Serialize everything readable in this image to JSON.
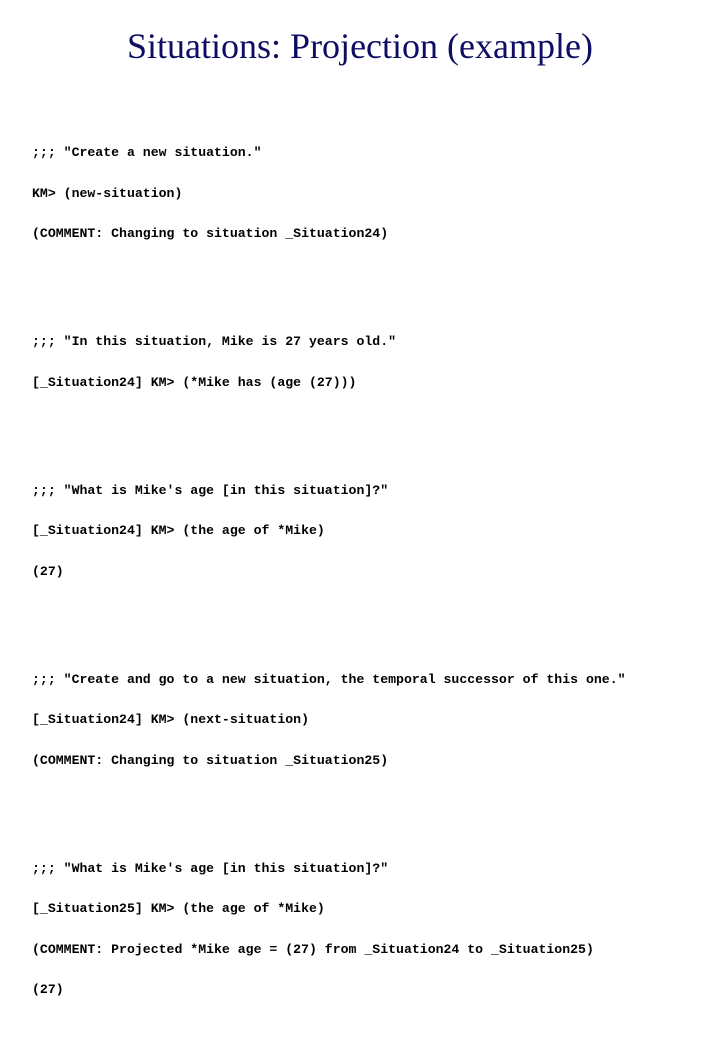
{
  "title": "Situations: Projection (example)",
  "blocks": [
    {
      "lines": [
        ";;; \"Create a new situation.\"",
        "KM> (new-situation)",
        "(COMMENT: Changing to situation _Situation24)"
      ]
    },
    {
      "lines": [
        ";;; \"In this situation, Mike is 27 years old.\"",
        "[_Situation24] KM> (*Mike has (age (27)))"
      ]
    },
    {
      "lines": [
        ";;; \"What is Mike's age [in this situation]?\"",
        "[_Situation24] KM> (the age of *Mike)",
        "(27)"
      ]
    },
    {
      "lines": [
        ";;; \"Create and go to a new situation, the temporal successor of this one.\"",
        "[_Situation24] KM> (next-situation)",
        "(COMMENT: Changing to situation _Situation25)"
      ]
    },
    {
      "lines": [
        ";;; \"What is Mike's age [in this situation]?\"",
        "[_Situation25] KM> (the age of *Mike)",
        "(COMMENT: Projected *Mike age = (27) from _Situation24 to _Situation25)",
        "(27)"
      ]
    }
  ]
}
